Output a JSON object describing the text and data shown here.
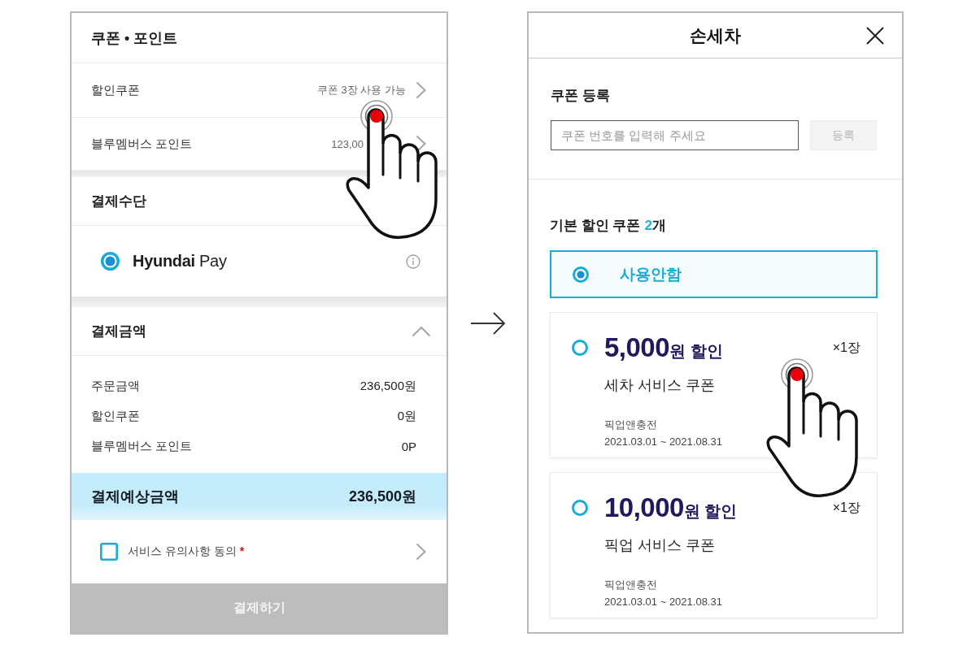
{
  "order_screen": {
    "coupon_point": {
      "title": "쿠폰 • 포인트",
      "rows": [
        {
          "label": "할인쿠폰",
          "value": "쿠폰 3장 사용 가능"
        },
        {
          "label": "블루멤버스 포인트",
          "value": "123,00"
        }
      ]
    },
    "payment_method": {
      "title": "결제수단",
      "methods": [
        {
          "label": "**Hyundai** Pay",
          "selected": true
        }
      ]
    },
    "payment_amount": {
      "title": "결제금액",
      "expanded": true,
      "rows": [
        {
          "label": "주문금액",
          "value": "236,500원"
        },
        {
          "label": "할인쿠폰",
          "value": "0원"
        },
        {
          "label": "블루멤버스 포인트",
          "value": "0P"
        }
      ],
      "total": {
        "label": "결제예상금액",
        "value": "236,500원"
      }
    },
    "agreement": {
      "label": "서비스 유의사항 동의",
      "required_mark": "*",
      "checked": false
    },
    "pay_button": {
      "label": "결제하기",
      "disabled": true
    }
  },
  "coupon_screen": {
    "title": "손세차",
    "registration": {
      "title": "쿠폰 등록",
      "placeholder": "쿠폰 번호를 입력해 주세요",
      "button": {
        "label": "등록",
        "disabled": true
      }
    },
    "coupon_list": {
      "heading": "기본 할인 쿠폰",
      "count": "2",
      "count_unit": "개",
      "options": [
        {
          "kind": "none",
          "label": "사용안함",
          "selected": true
        },
        {
          "kind": "coupon",
          "amount": "5,000",
          "amount_suffix": "원 할인",
          "quantity": "×1장",
          "name": "세차 서비스 쿠폰",
          "issuer": "픽업앤충전",
          "period": "2021.03.01 ~ 2021.08.31",
          "selected": false
        },
        {
          "kind": "coupon",
          "amount": "10,000",
          "amount_suffix": "원 할인",
          "quantity": "×1장",
          "name": "픽업 서비스 쿠폰",
          "issuer": "픽업앤충전",
          "period": "2021.03.01 ~ 2021.08.31",
          "selected": false
        }
      ]
    }
  }
}
